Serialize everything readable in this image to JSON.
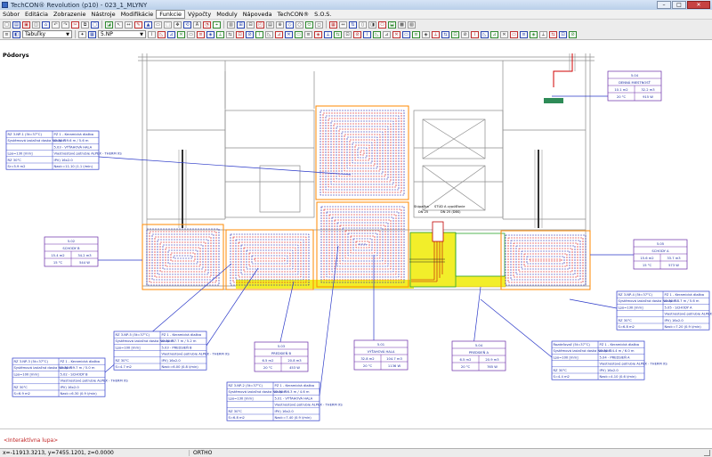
{
  "window": {
    "title": "TechCON® Revolution  (p10) - 023_1_MLYNY"
  },
  "menu": {
    "items": [
      "Súbor",
      "Editácia",
      "Zobrazenie",
      "Nástroje",
      "Modifikácie",
      "Funkcie",
      "Výpočty",
      "Moduly",
      "Nápoveda",
      "TechCON®",
      "S.O.S."
    ],
    "active": "Funkcie"
  },
  "toolbar": {
    "layer_combo": "Tabuľky",
    "floor_combo": "5.NP"
  },
  "view": {
    "title": "Pôdorys"
  },
  "drawing": {
    "room_tags": [
      {
        "code": "5.04",
        "name": "DENNÁ MIESTNOSŤ",
        "area": "10.1 m2",
        "vol": "32.2 m3",
        "temp": "20 °C",
        "power": "915 W"
      },
      {
        "code": "5.02",
        "name": "SCHODY B",
        "area": "15.4 m2",
        "vol": "34.2 m3",
        "temp": "15 °C",
        "power": "544 W"
      },
      {
        "code": "5.03",
        "name": "PREDSIEŇ B",
        "area": "6.5 m2",
        "vol": "20.8 m3",
        "temp": "20 °C",
        "power": "453 W"
      },
      {
        "code": "5.01",
        "name": "VÝŤAHOVÁ HALA",
        "area": "32.8 m2",
        "vol": "104.7 m3",
        "temp": "20 °C",
        "power": "1136 W"
      },
      {
        "code": "5.04",
        "name": "PREDSIEŇ A",
        "area": "6.5 m2",
        "vol": "20.9 m3",
        "temp": "20 °C",
        "power": "765 W"
      },
      {
        "code": "5.05",
        "name": "SCHODY A",
        "area": "15.6 m2",
        "vol": "33.7 m3",
        "temp": "15 °C",
        "power": "573 W"
      }
    ],
    "circuit_boxes": [
      {
        "rows": [
          [
            "RZ 3.NP-1  (5t=37°C)",
            "PZ 1 - Keramická dlažba"
          ],
          [
            "Systémová izolačná doska NO 30 R",
            "Izolp=59.6 m / 5.6 m"
          ],
          [
            "",
            "5.03 - VÝŤAHOVÁ HALA"
          ],
          [
            "Lpo=130 [mm]",
            "Vlastnostové potrubie ALPEX - THERM XS"
          ],
          [
            "RZ 30°C",
            "IPV) 16x2.0"
          ],
          [
            "Sr=5.9 m2",
            "Nast:=11.10 (1.1 l/min)"
          ]
        ]
      },
      {
        "rows": [
          [
            "RZ 3.NP-3  (5t=37°C)",
            "PZ 1 - Keramická dlažba"
          ],
          [
            "Systémová izolačná doska NO 30 R",
            "Izolp=59.7 m / 5.0 m"
          ],
          [
            "Lpo=100 [mm]",
            "5.02 - SCHODY B"
          ],
          [
            "",
            "Vlastnostové potrubie ALPEX - THERM XS"
          ],
          [
            "RZ 30°C",
            "IPV) 16x2.0"
          ],
          [
            "S=6.9 m2",
            "Nast:=6.30 (0.9 l/min)"
          ]
        ]
      },
      {
        "rows": [
          [
            "RZ 3.NP-5  (5t=37°C)",
            "PZ 1 - Keramická dlažba"
          ],
          [
            "Systémová izolačná doska NO 30 R",
            "Izolp=87.7 m / 5.2 m"
          ],
          [
            "Lpo=100 [mm]",
            "5.03 - PREDSIEŇ B"
          ],
          [
            "",
            "Vlastnostové potrubie ALPEX - THERM XS"
          ],
          [
            "RZ 30°C",
            "IPV) 16x2.0"
          ],
          [
            "S=4.7 m2",
            "Nast:=6.00 (0.8 l/min)"
          ]
        ]
      },
      {
        "rows": [
          [
            "RZ 3.NP-2  (5t=37°C)",
            "PZ 1 - Keramická dlažba"
          ],
          [
            "Systémová izolačná doska NO 30 R",
            "Izolp=56.3 m / 4.6 m"
          ],
          [
            "Lpo=130 [mm]",
            "5.01 - VÝŤAHOVÁ HALA"
          ],
          [
            "",
            "Vlastnostové potrubie ALPEX - THERM XS"
          ],
          [
            "RZ 30°C",
            "IPV) 16x2.0"
          ],
          [
            "S=6.8 m2",
            "Nast:=7.40 (0.9 l/min)"
          ]
        ]
      },
      {
        "rows": [
          [
            "Rozdeľovač  (5t=37°C)",
            "PZ 1 - Keramická dlažba"
          ],
          [
            "Systémová izolačná doska NO 30 R",
            "Izolp=24.4 m / 6.0 m"
          ],
          [
            "Lpo=100 [mm]",
            "5.04 - PREDSIEŇ A"
          ],
          [
            "",
            "Vlastnostové potrubie ALPEX - THERM XS"
          ],
          [
            "RZ 30°C",
            "IPV) 16x2.0"
          ],
          [
            "S=4.4 m2",
            "Nast:=4.10 (0.6 l/min)"
          ]
        ]
      },
      {
        "rows": [
          [
            "RZ 3.NP-4  (5t=37°C)",
            "PZ 1 - Keramická dlažba"
          ],
          [
            "Systémová izolačná doska NO 30 R",
            "Izolp=58.7 m / 5.6 m"
          ],
          [
            "Lpo=130 [mm]",
            "5.05 - SCHODY A"
          ],
          [
            "",
            "Vlastnostové potrubie ALPEX - THERM XS"
          ],
          [
            "RZ 30°C",
            "IPV) 16x2.0"
          ],
          [
            "S=6.8 m2",
            "Nast:=7.20 (0.9 l/min)"
          ]
        ]
      }
    ],
    "manifold_text": [
      "Stúpačka",
      "STÚD A vypúšťanie",
      "DN 25",
      "DN 25 (DBS)"
    ]
  },
  "command_line": {
    "prompt": "<Interaktívna lupa>"
  },
  "status": {
    "coords": "x=-11913.3213,  y=7455.1201,  z=0.0000",
    "mode": "ORTHO"
  }
}
